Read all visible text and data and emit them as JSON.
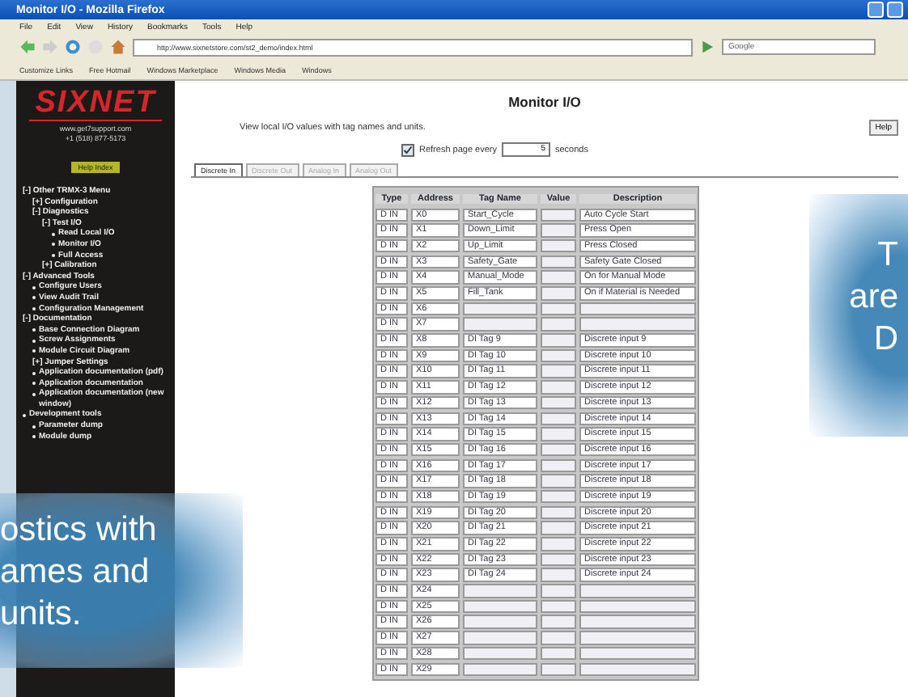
{
  "window": {
    "title": "Monitor I/O - Mozilla Firefox"
  },
  "menu_bar": [
    "File",
    "Edit",
    "View",
    "History",
    "Bookmarks",
    "Tools",
    "Help"
  ],
  "address_bar": {
    "url": "http://www.sixnetstore.com/st2_demo/index.html"
  },
  "search": {
    "placeholder": "Google"
  },
  "bookmarks": [
    "Customize Links",
    "Free Hotmail",
    "Windows Marketplace",
    "Windows Media",
    "Windows"
  ],
  "sidebar": {
    "logo": "SIXNET",
    "website": "www.get7support.com",
    "phone": "+1 (518) 877-5173",
    "help_link": "Help Index",
    "items": [
      {
        "label": "[-] Other TRMX-3 Menu",
        "kind": "node",
        "children": [
          {
            "label": "[+] Configuration",
            "kind": "node"
          },
          {
            "label": "[-] Diagnostics",
            "kind": "node",
            "children": [
              {
                "label": "[-] Test I/O",
                "kind": "node",
                "children": [
                  {
                    "label": "Read Local I/O",
                    "kind": "leaf"
                  },
                  {
                    "label": "Monitor I/O",
                    "kind": "leaf"
                  },
                  {
                    "label": "Full Access",
                    "kind": "leaf"
                  }
                ]
              },
              {
                "label": "[+] Calibration",
                "kind": "node"
              }
            ]
          }
        ]
      },
      {
        "label": "[-] Advanced Tools",
        "kind": "node",
        "children": [
          {
            "label": "Configure Users",
            "kind": "leaf"
          },
          {
            "label": "View Audit Trail",
            "kind": "leaf"
          },
          {
            "label": "Configuration Management",
            "kind": "leaf"
          }
        ]
      },
      {
        "label": "[-] Documentation",
        "kind": "node",
        "children": [
          {
            "label": "Base Connection Diagram",
            "kind": "leaf"
          },
          {
            "label": "Screw Assignments",
            "kind": "leaf"
          },
          {
            "label": "Module Circuit Diagram",
            "kind": "leaf"
          },
          {
            "label": "[+] Jumper Settings",
            "kind": "node"
          },
          {
            "label": "Application documentation (pdf)",
            "kind": "leaf"
          },
          {
            "label": "Application documentation",
            "kind": "leaf"
          },
          {
            "label": "Application documentation (new window)",
            "kind": "leaf"
          }
        ]
      },
      {
        "label": "Development tools",
        "kind": "leaf",
        "children": [
          {
            "label": "Parameter dump",
            "kind": "leaf"
          },
          {
            "label": "Module dump",
            "kind": "leaf"
          }
        ]
      }
    ]
  },
  "page": {
    "title": "Monitor I/O",
    "description": "View local I/O values with tag names and units.",
    "help_button": "Help",
    "refresh": {
      "checked": true,
      "label": "Refresh page every",
      "value": "5",
      "unit": "seconds"
    }
  },
  "tabs": [
    {
      "label": "Discrete In",
      "selected": true
    },
    {
      "label": "Discrete Out",
      "selected": false
    },
    {
      "label": "Analog In",
      "selected": false
    },
    {
      "label": "Analog Out",
      "selected": false
    }
  ],
  "table": {
    "columns": [
      "Type",
      "Address",
      "Tag Name",
      "Value",
      "Description"
    ],
    "rows": [
      [
        "D IN",
        "X0",
        "Start_Cycle",
        "",
        "Auto Cycle Start"
      ],
      [
        "D IN",
        "X1",
        "Down_Limit",
        "",
        "Press Open"
      ],
      [
        "D IN",
        "X2",
        "Up_Limit",
        "",
        "Press Closed"
      ],
      [
        "D IN",
        "X3",
        "Safety_Gate",
        "",
        "Safety Gate Closed"
      ],
      [
        "D IN",
        "X4",
        "Manual_Mode",
        "",
        "On for Manual Mode"
      ],
      [
        "D IN",
        "X5",
        "Fill_Tank",
        "",
        "On if Material is Needed"
      ],
      [
        "D IN",
        "X6",
        "",
        "",
        ""
      ],
      [
        "D IN",
        "X7",
        "",
        "",
        ""
      ],
      [
        "D IN",
        "X8",
        "DI Tag 9",
        "",
        "Discrete input 9"
      ],
      [
        "D IN",
        "X9",
        "DI Tag 10",
        "",
        "Discrete input 10"
      ],
      [
        "D IN",
        "X10",
        "DI Tag 11",
        "",
        "Discrete input 11"
      ],
      [
        "D IN",
        "X11",
        "DI Tag 12",
        "",
        "Discrete input 12"
      ],
      [
        "D IN",
        "X12",
        "DI Tag 13",
        "",
        "Discrete input 13"
      ],
      [
        "D IN",
        "X13",
        "DI Tag 14",
        "",
        "Discrete input 14"
      ],
      [
        "D IN",
        "X14",
        "DI Tag 15",
        "",
        "Discrete input 15"
      ],
      [
        "D IN",
        "X15",
        "DI Tag 16",
        "",
        "Discrete input 16"
      ],
      [
        "D IN",
        "X16",
        "DI Tag 17",
        "",
        "Discrete input 17"
      ],
      [
        "D IN",
        "X17",
        "DI Tag 18",
        "",
        "Discrete input 18"
      ],
      [
        "D IN",
        "X18",
        "DI Tag 19",
        "",
        "Discrete input 19"
      ],
      [
        "D IN",
        "X19",
        "DI Tag 20",
        "",
        "Discrete input 20"
      ],
      [
        "D IN",
        "X20",
        "DI Tag 21",
        "",
        "Discrete input 21"
      ],
      [
        "D IN",
        "X21",
        "DI Tag 22",
        "",
        "Discrete input 22"
      ],
      [
        "D IN",
        "X22",
        "DI Tag 23",
        "",
        "Discrete input 23"
      ],
      [
        "D IN",
        "X23",
        "DI Tag 24",
        "",
        "Discrete input 24"
      ],
      [
        "D IN",
        "X24",
        "",
        "",
        ""
      ],
      [
        "D IN",
        "X25",
        "",
        "",
        ""
      ],
      [
        "D IN",
        "X26",
        "",
        "",
        ""
      ],
      [
        "D IN",
        "X27",
        "",
        "",
        ""
      ],
      [
        "D IN",
        "X28",
        "",
        "",
        ""
      ],
      [
        "D IN",
        "X29",
        "",
        "",
        ""
      ]
    ]
  },
  "callouts": [
    {
      "lines": [
        "ostics with",
        "ames and",
        "units."
      ]
    },
    {
      "lines": [
        "T",
        "are",
        "D"
      ]
    }
  ]
}
